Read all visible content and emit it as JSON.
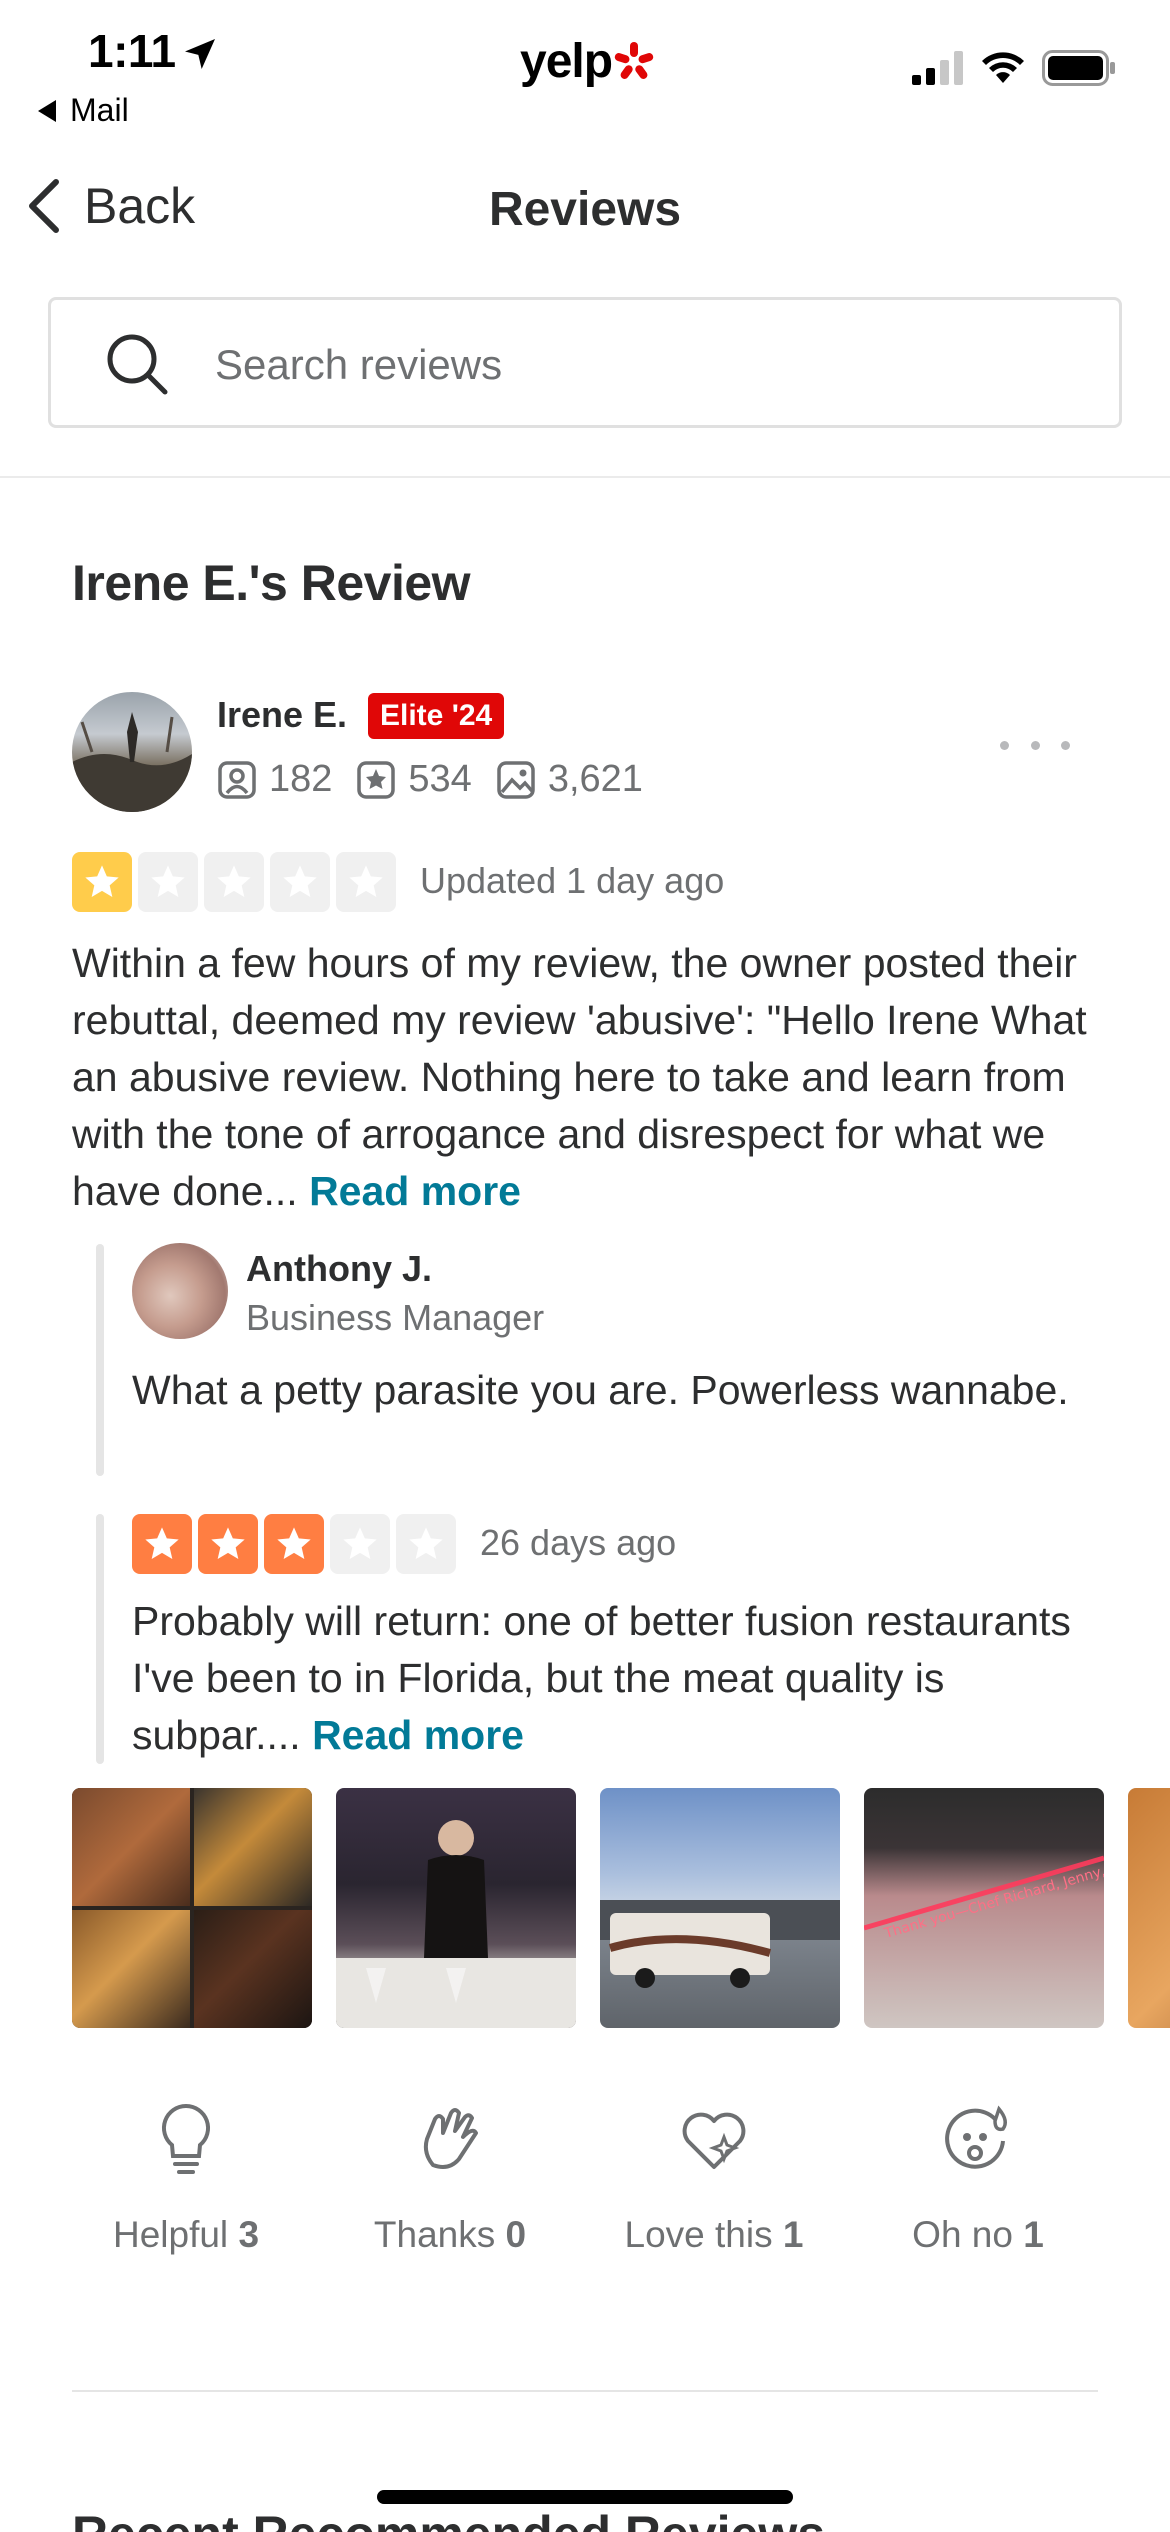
{
  "status_bar": {
    "time": "1:11",
    "back_app": "Mail",
    "logo_text": "yelp"
  },
  "nav": {
    "back_label": "Back",
    "title": "Reviews"
  },
  "search": {
    "placeholder": "Search reviews",
    "value": ""
  },
  "review": {
    "section_title": "Irene E.'s Review",
    "user": {
      "name": "Irene E.",
      "badge": "Elite '24",
      "stats": {
        "friends": "182",
        "reviews": "534",
        "photos": "3,621"
      }
    },
    "rating": 1,
    "rating_max": 5,
    "date": "Updated 1 day ago",
    "text": "Within a few hours of my review, the owner posted their rebuttal, deemed my review 'abusive': \"Hello Irene What an abusive review. Nothing here to take and learn from with the tone of arrogance and disrespect for what we have done... ",
    "read_more": "Read more"
  },
  "business_reply": {
    "name": "Anthony J.",
    "role": "Business Manager",
    "text": "What a petty parasite you are. Powerless wannabe."
  },
  "previous_review": {
    "rating": 3,
    "rating_max": 5,
    "date": "26 days ago",
    "text": "Probably will return: one of better fusion restaurants I've been to in Florida, but the meat quality is subpar.... ",
    "read_more": "Read more"
  },
  "photos": [
    {
      "icon": "food-collage"
    },
    {
      "icon": "restaurant-server"
    },
    {
      "icon": "rv-parking-lot"
    },
    {
      "icon": "neon-sign-wall"
    },
    {
      "icon": "food-dish"
    }
  ],
  "neon_sign_text": "Thank you—Chef Richard, Jenny, Lily & Violet #grateful",
  "reactions": [
    {
      "label": "Helpful",
      "count": "3",
      "icon": "lightbulb-icon"
    },
    {
      "label": "Thanks",
      "count": "0",
      "icon": "clapping-hands-icon"
    },
    {
      "label": "Love this",
      "count": "1",
      "icon": "heart-sparkle-icon"
    },
    {
      "label": "Oh no",
      "count": "1",
      "icon": "shocked-face-icon"
    }
  ],
  "next_section_heading": "Recent Recommended Reviews",
  "colors": {
    "brand_red": "#e00707",
    "star_1": "#ffcc4b",
    "star_3": "#ff7e42",
    "star_empty": "#f0f0f0",
    "link": "#027a97",
    "text": "#2d2e2f",
    "muted": "#6e7072"
  }
}
